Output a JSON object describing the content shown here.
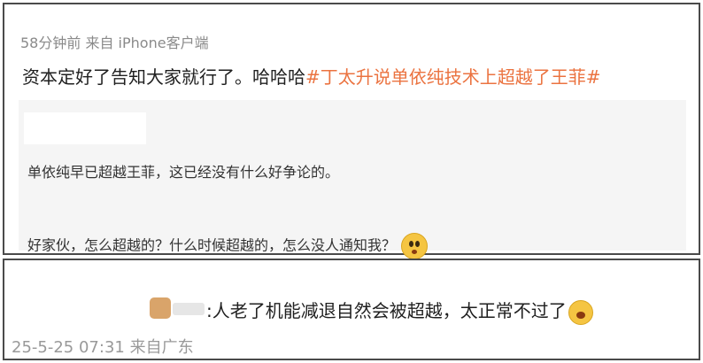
{
  "post": {
    "time": "58分钟前",
    "source": "来自 iPhone客户端",
    "text": "资本定好了告知大家就行了。哈哈哈",
    "hashtag": "#丁太升说单依纯技术上超越了王菲#"
  },
  "quoted": {
    "line1": "单依纯早已超越王菲，这已经没有什么好争论的。",
    "line2": "好家伙，怎么超越的？什么时候超越的，怎么没人通知我？",
    "emoji": "surprised-face-icon"
  },
  "reply": {
    "text": ":人老了机能减退自然会被超越，太正常不过了",
    "emoji": "crying-face-icon",
    "timestamp": "25-5-25 07:31",
    "location": "来自广东"
  },
  "colors": {
    "hashtag": "#eb7340",
    "meta": "#8a8a8a",
    "quote_bg": "#f5f5f5"
  }
}
